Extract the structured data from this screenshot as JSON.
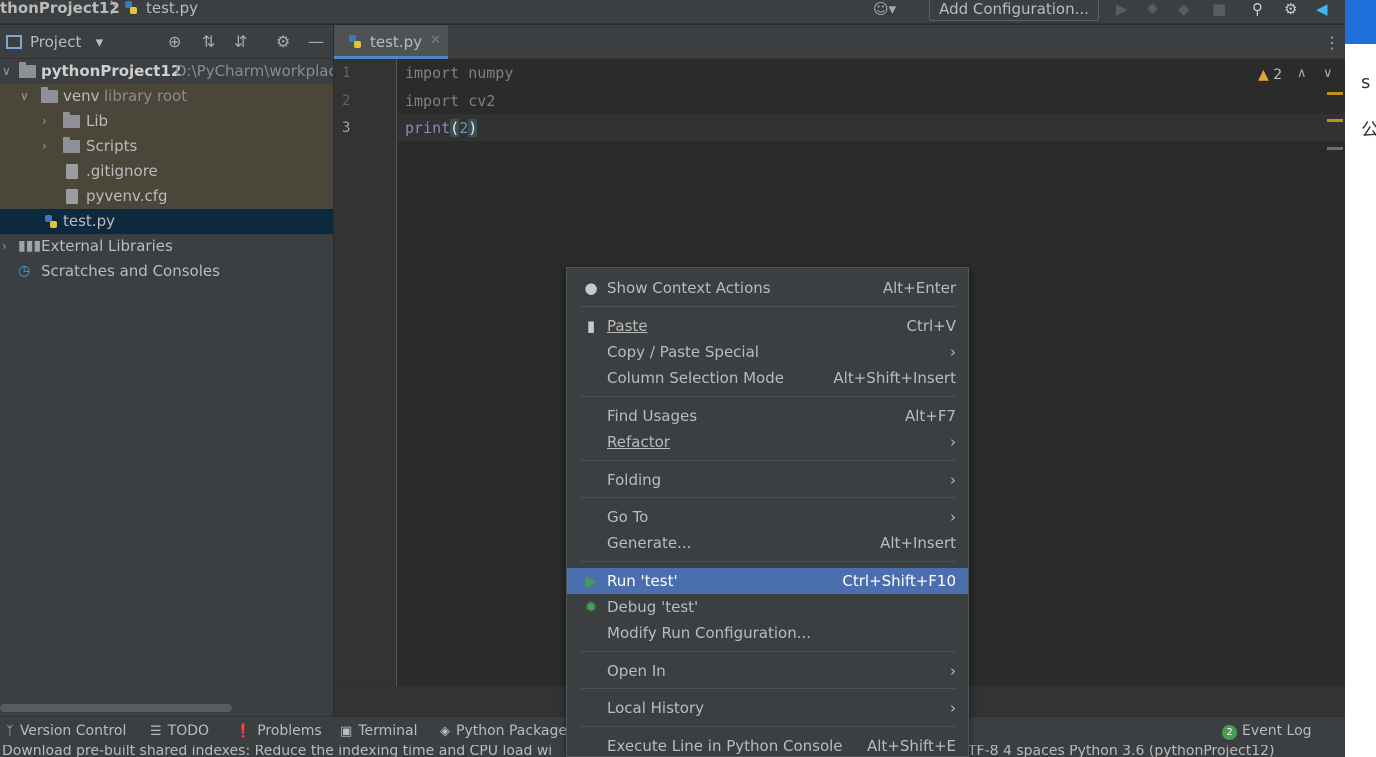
{
  "navbar": {
    "project": "thonProject12",
    "separator": "〉",
    "file": "test.py",
    "add_configuration": "Add Configuration..."
  },
  "project_panel": {
    "title": "Project",
    "tree": [
      {
        "label": "pythonProject12",
        "note": "D:\\PyCharm\\workplac"
      },
      {
        "label": "venv",
        "note": "library root"
      },
      {
        "label": "Lib"
      },
      {
        "label": "Scripts"
      },
      {
        "label": ".gitignore"
      },
      {
        "label": "pyvenv.cfg"
      },
      {
        "label": "test.py"
      },
      {
        "label": "External Libraries"
      },
      {
        "label": "Scratches and Consoles"
      }
    ]
  },
  "editor": {
    "tab": "test.py",
    "line_numbers": [
      "1",
      "2",
      "3"
    ],
    "lines": {
      "l1": "import numpy",
      "l2": "import cv2",
      "l3_fn": "print",
      "l3_open": "(",
      "l3_num": "2",
      "l3_close": ")"
    },
    "warnings_count": "2"
  },
  "context_menu": {
    "items": [
      {
        "label": "Show Context Actions",
        "shortcut": "Alt+Enter"
      },
      {
        "label": "Paste",
        "shortcut": "Ctrl+V"
      },
      {
        "label": "Copy / Paste Special",
        "shortcut": ""
      },
      {
        "label": "Column Selection Mode",
        "shortcut": "Alt+Shift+Insert"
      },
      {
        "label": "Find Usages",
        "shortcut": "Alt+F7"
      },
      {
        "label": "Refactor",
        "shortcut": ""
      },
      {
        "label": "Folding",
        "shortcut": ""
      },
      {
        "label": "Go To",
        "shortcut": ""
      },
      {
        "label": "Generate...",
        "shortcut": "Alt+Insert"
      },
      {
        "label": "Run 'test'",
        "shortcut": "Ctrl+Shift+F10"
      },
      {
        "label": "Debug 'test'",
        "shortcut": ""
      },
      {
        "label": "Modify Run Configuration...",
        "shortcut": ""
      },
      {
        "label": "Open In",
        "shortcut": ""
      },
      {
        "label": "Local History",
        "shortcut": ""
      },
      {
        "label": "Execute Line in Python Console",
        "shortcut": "Alt+Shift+E"
      }
    ],
    "selected_index": 9
  },
  "tool_windows": {
    "version_control": "Version Control",
    "todo": "TODO",
    "problems": "Problems",
    "terminal": "Terminal",
    "python_packages": "Python Packages",
    "event_log": "Event Log",
    "event_log_badge": "2"
  },
  "status_bar": {
    "message": "Download pre-built shared indexes: Reduce the indexing time and CPU load wi",
    "right": "TF-8   4 spaces   Python 3.6 (pythonProject12)"
  },
  "other_window": {
    "glyph_1": "s",
    "glyph_2": "公"
  },
  "colors": {
    "selected_menu": "#4b6eaf",
    "accent_tab": "#4a88c7",
    "run_icon": "#499c54",
    "warning": "#e2a53a"
  }
}
